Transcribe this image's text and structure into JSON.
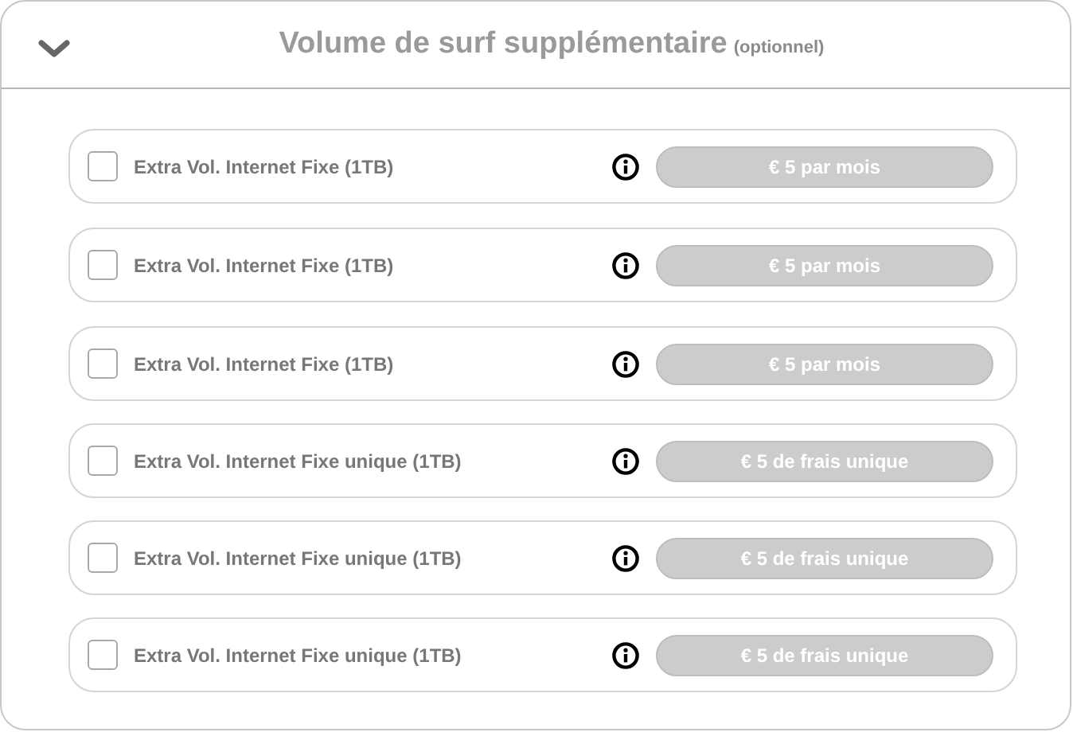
{
  "header": {
    "expanded": true,
    "title": "Volume de surf supplémentaire",
    "note": "(optionnel)"
  },
  "options": [
    {
      "label": "Extra Vol. Internet Fixe (1TB)",
      "checked": false,
      "price": "€ 5 par mois"
    },
    {
      "label": "Extra Vol. Internet Fixe (1TB)",
      "checked": false,
      "price": "€ 5 par mois"
    },
    {
      "label": "Extra Vol. Internet Fixe (1TB)",
      "checked": false,
      "price": "€ 5 par mois"
    },
    {
      "label": "Extra Vol. Internet Fixe unique (1TB)",
      "checked": false,
      "price": "€ 5 de frais unique"
    },
    {
      "label": "Extra Vol. Internet Fixe unique (1TB)",
      "checked": false,
      "price": "€ 5 de frais unique"
    },
    {
      "label": "Extra Vol. Internet Fixe unique (1TB)",
      "checked": false,
      "price": "€ 5 de frais unique"
    }
  ]
}
